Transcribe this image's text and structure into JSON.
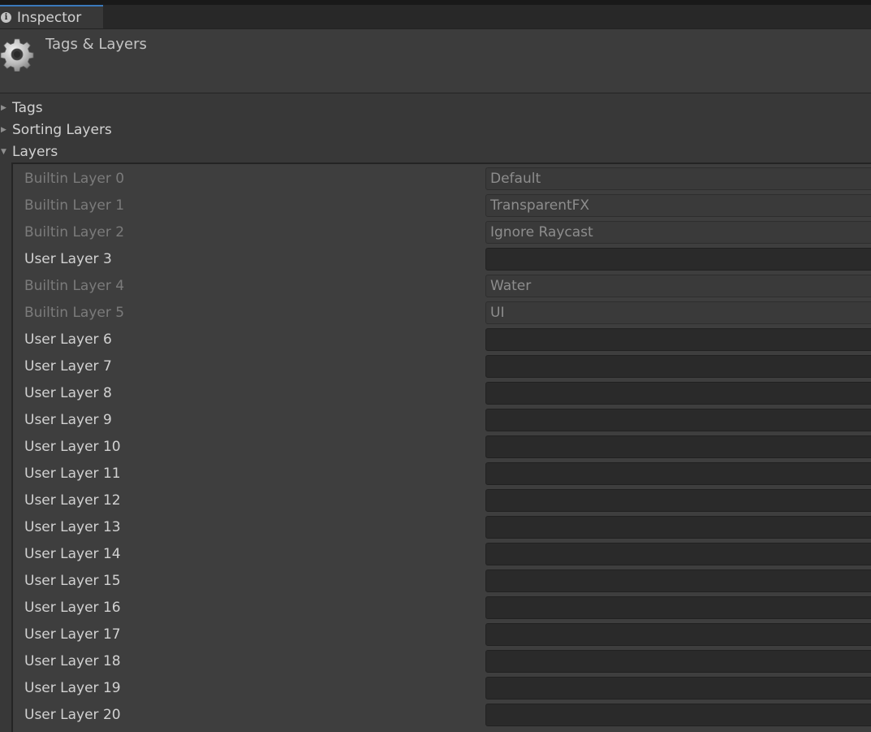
{
  "window": {
    "tab_label": "Inspector",
    "tab_icon": "info-icon"
  },
  "header": {
    "title": "Tags & Layers",
    "icon": "gear-icon"
  },
  "foldouts": [
    {
      "label": "Tags",
      "expanded": false
    },
    {
      "label": "Sorting Layers",
      "expanded": false
    },
    {
      "label": "Layers",
      "expanded": true
    }
  ],
  "layers": [
    {
      "label": "Builtin Layer 0",
      "value": "Default",
      "builtin": true
    },
    {
      "label": "Builtin Layer 1",
      "value": "TransparentFX",
      "builtin": true
    },
    {
      "label": "Builtin Layer 2",
      "value": "Ignore Raycast",
      "builtin": true
    },
    {
      "label": "User Layer 3",
      "value": "",
      "builtin": false
    },
    {
      "label": "Builtin Layer 4",
      "value": "Water",
      "builtin": true
    },
    {
      "label": "Builtin Layer 5",
      "value": "UI",
      "builtin": true
    },
    {
      "label": "User Layer 6",
      "value": "",
      "builtin": false
    },
    {
      "label": "User Layer 7",
      "value": "",
      "builtin": false
    },
    {
      "label": "User Layer 8",
      "value": "",
      "builtin": false
    },
    {
      "label": "User Layer 9",
      "value": "",
      "builtin": false
    },
    {
      "label": "User Layer 10",
      "value": "",
      "builtin": false
    },
    {
      "label": "User Layer 11",
      "value": "",
      "builtin": false
    },
    {
      "label": "User Layer 12",
      "value": "",
      "builtin": false
    },
    {
      "label": "User Layer 13",
      "value": "",
      "builtin": false
    },
    {
      "label": "User Layer 14",
      "value": "",
      "builtin": false
    },
    {
      "label": "User Layer 15",
      "value": "",
      "builtin": false
    },
    {
      "label": "User Layer 16",
      "value": "",
      "builtin": false
    },
    {
      "label": "User Layer 17",
      "value": "",
      "builtin": false
    },
    {
      "label": "User Layer 18",
      "value": "",
      "builtin": false
    },
    {
      "label": "User Layer 19",
      "value": "",
      "builtin": false
    },
    {
      "label": "User Layer 20",
      "value": "",
      "builtin": false
    }
  ],
  "colors": {
    "background": "#383838",
    "tab_accent": "#3a79bb",
    "field_dark": "#2a2a2a",
    "builtin_text": "#7b7b7b"
  }
}
